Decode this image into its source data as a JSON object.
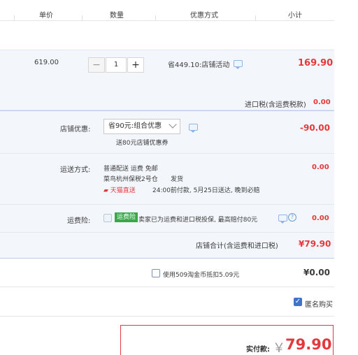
{
  "header": {
    "col_price": "单价",
    "col_qty": "数量",
    "col_promo": "优惠方式",
    "col_subtotal": "小计"
  },
  "item": {
    "price": "619.00",
    "quantity": "1",
    "promo": "省449.10:店铺活动",
    "subtotal": "169.90",
    "tax_label": "进口税(含运费税款)",
    "tax_value": "0.00"
  },
  "shop": {
    "discount_label": "店铺优惠:",
    "discount_select": "省90元:组合优惠",
    "discount_value": "-90.00",
    "coupon_note": "送80元店铺优惠券",
    "shipping_label": "运送方式:",
    "shipping_method": "普通配送 运费 免邮",
    "shipping_warehouse": "菜鸟杭州保税2号仓",
    "shipping_ship": "发货",
    "tmall_direct": "天猫直送",
    "delivery_promise": "24:00前付款, 5月25日送达, 晚到必赔",
    "shipping_value": "0.00",
    "insurance_label": "运费险:",
    "insurance_badge": "运费险",
    "insurance_desc": "卖家已为运费和进口税投保, 最高赔付80元",
    "insurance_value": "0.00",
    "shop_total_label": "店铺合计(含运费和进口税)",
    "shop_total_value": "¥79.90"
  },
  "coins": {
    "label": "使用509淘金币抵扣5.09元",
    "value": "¥0.00"
  },
  "anonymous": {
    "label": "匿名购买",
    "checked": true
  },
  "payment": {
    "label": "实付款:",
    "currency": "￥",
    "amount": "79.90"
  },
  "colors": {
    "price_red": "#e4393c",
    "panel_bg": "#f3f6fb",
    "checkbox_blue": "#3d74c9",
    "insurance_green": "#3aa74a"
  }
}
